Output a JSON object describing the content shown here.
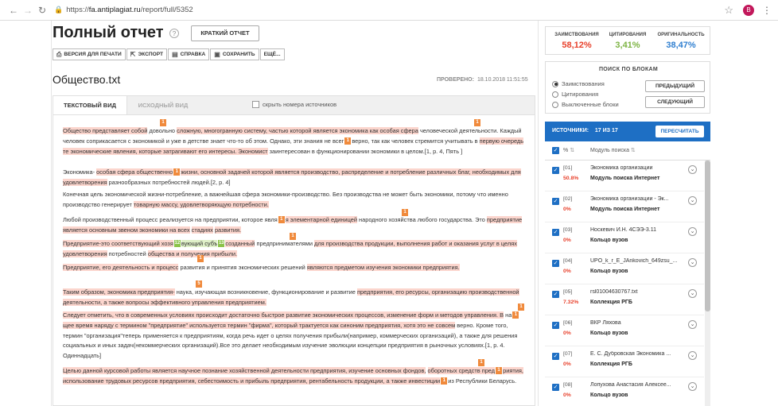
{
  "browser": {
    "url_scheme": "https://",
    "url_host": "fa.antiplagiat.ru",
    "url_path": "/report/full/5352",
    "avatar_letter": "B"
  },
  "header": {
    "title": "Полный отчет",
    "help": "?",
    "short_report_label": "КРАТКИЙ ОТЧЕТ"
  },
  "toolbar": {
    "print_label": "ВЕРСИЯ ДЛЯ ПЕЧАТИ",
    "export_label": "ЭКСПОРТ",
    "help_label": "СПРАВКА",
    "save_label": "СОХРАНИТЬ",
    "more_label": "ЕЩЁ..."
  },
  "document": {
    "filename": "Общество.txt",
    "checked_label": "ПРОВЕРЕНО:",
    "checked_date": "18.10.2018 11:51:55"
  },
  "tabs": {
    "text_view": "ТЕКСТОВЫЙ ВИД",
    "source_view": "ИСХОДНЫЙ ВИД",
    "hide_numbers": "скрыть номера источников"
  },
  "text": {
    "p1": [
      "Общество представляет собой",
      "1",
      "довольно",
      "сложную, многогранную систему, частью которой является экономика как особая сфера",
      "1",
      "человеческой деятельности. Каждый человек соприкасается с экономикой и уже в детстве знает что-то об этом. Однако, эти знания не всег",
      "1",
      "верно, так как человек стремится учитывать в",
      "первую очередь те экономические явления, которые затрагивают его интересы. Экономист",
      "заинтересован в функционировании экономики в целом.[1, р. 4, Пять ]"
    ],
    "p2": [
      "Экономика-",
      "особая сфера общественно",
      "1",
      "жизни, основной задачей которой является производство, распределение и потребление различных благ, необходимых для удовлетворения",
      "разнообразных потребностей людей.[2, р. 4]"
    ],
    "p3": [
      "Конечная цель экономической жизни-потребление, а важнейшая сфера экономики-производство. Без производства не может быть экономики, потому что именно производство генерирует",
      "товарную массу, удовлетворяющую потребности."
    ],
    "p4": [
      "Любой производственный процесс реализуется на предприятии, которое явля",
      "1",
      "я элементарной единицей",
      "1",
      "народного хозяйства любого государства. Это",
      "предприятие является основным звеном экономики на всех",
      "стадиях",
      "развития."
    ],
    "p5": [
      "Предприятие-это соответствующий хозя",
      "12",
      "вующий субъ",
      "13",
      "созданный",
      "предпринимателями",
      "для производства продукции, выполнения работ и оказания услуг в целях удовлетворения",
      "потребностей",
      "общества и получения прибыли."
    ],
    "p6": [
      "Предприятие, его деятельность и процесс",
      "развития и принятия экономических решений",
      "являются предметом изучения экономики предприятия."
    ],
    "p7": [
      "Таким образом, экономика предприятия-",
      "наука, изучающая возникновение, функционирование и развитие",
      "предприятия, его ресурсы, организацию производственной деятельности, а также вопросы эффективного управления предприятием."
    ],
    "p8": [
      "Следует отметить, что в современных условиях происходит достаточно быстрое развитие экономических процессов, изменение форм и методов управления. В",
      "на",
      "1",
      "щее время наряду с термином \"предприятие\" используется термин \"фирма\", который трактуется как синоним предприятия, хотя это не совсем",
      "верно. Кроме того, термин \"организация\"теперь применяется к предприятиям, когда речь идет о целях получения прибыли(например, коммерческих организаций), а также для решения социальных и иных задач(некоммерческих организаций).Все это делает необходимым изучение эволюции концепции предприятия в рыночных условиях.[1, р. 4. Одиннадцать]"
    ],
    "p9": [
      "Целью данной курсовой работы является научное познание хозяйственной деятельности предприятия, изучение основных фондов,",
      "оборотных средств пред",
      "1",
      "риятия, использование трудовых ресурсов предприятия, себестоимость и прибыль предприятия, рентабельность продукции, а также инвестиции",
      "1",
      "из Республики Беларусь."
    ],
    "badges": [
      "1",
      "1",
      "1",
      "1",
      "1",
      "5",
      "1",
      "1",
      "1",
      "1"
    ]
  },
  "stats": {
    "borrow_label": "ЗАИМСТВОВАНИЯ",
    "borrow_value": "58,12%",
    "cite_label": "ЦИТИРОВАНИЯ",
    "cite_value": "3,41%",
    "orig_label": "ОРИГИНАЛЬНОСТЬ",
    "orig_value": "38,47%",
    "colors": {
      "borrow": "#e8412c",
      "cite": "#7cb342",
      "orig": "#2f7fd0"
    }
  },
  "block_search": {
    "title": "ПОИСК ПО БЛОКАМ",
    "opt1": "Заимствования",
    "opt2": "Цитирования",
    "opt3": "Выключенные блоки",
    "prev": "ПРЕДЫДУЩИЙ",
    "next": "СЛЕДУЮЩИЙ"
  },
  "sources": {
    "label": "ИСТОЧНИКИ:",
    "count": "17 ИЗ 17",
    "recount": "ПЕРЕСЧИТАТЬ",
    "col_pct": "%",
    "col_module": "Модуль поиска",
    "items": [
      {
        "num": "[01]",
        "pct": "50.8%",
        "name": "Экономика организации",
        "module": "Модуль поиска Интернет"
      },
      {
        "num": "[02]",
        "pct": "0%",
        "name": "Экономика организации - Эк...",
        "module": "Модуль поиска Интернет"
      },
      {
        "num": "[03]",
        "pct": "0%",
        "name": "Носкевич И.Н. 4СЭЭ-3.11",
        "module": "Кольцо вузов"
      },
      {
        "num": "[04]",
        "pct": "0%",
        "name": "UPO_k_r_E_JAnkovich_649zsu_...",
        "module": "Кольцо вузов"
      },
      {
        "num": "[05]",
        "pct": "7.32%",
        "name": "rsl01004630767.txt",
        "module": "Коллекция РГБ"
      },
      {
        "num": "[06]",
        "pct": "0%",
        "name": "ВКР Ляхова",
        "module": "Кольцо вузов"
      },
      {
        "num": "[07]",
        "pct": "0%",
        "name": "Е. С. Дубровская Экономика ...",
        "module": "Коллекция РГБ"
      },
      {
        "num": "[08]",
        "pct": "0%",
        "name": "Лопухова Анастасия Алексее...",
        "module": "Кольцо вузов"
      }
    ]
  }
}
